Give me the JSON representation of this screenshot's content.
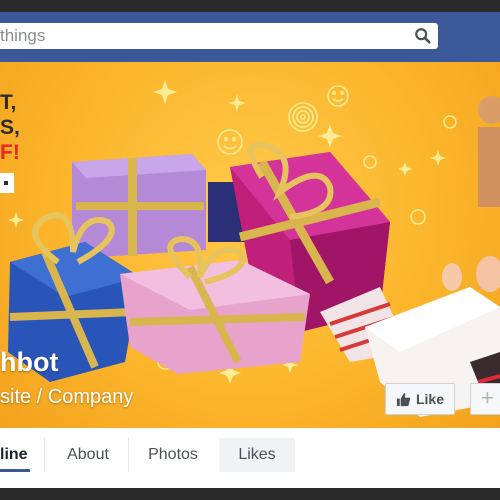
{
  "search": {
    "text": "things"
  },
  "cover": {
    "promo_lines": [
      "T,",
      "S,",
      "F!"
    ]
  },
  "page": {
    "name": "hbot",
    "category": "site / Company"
  },
  "actions": {
    "like_label": "Like",
    "more_label": "+"
  },
  "tabs": [
    "line",
    "About",
    "Photos",
    "Likes"
  ],
  "colors": {
    "facebook_blue": "#3b5998",
    "cover_yellow": "#fbb62c",
    "promo_red": "#e5262a"
  }
}
